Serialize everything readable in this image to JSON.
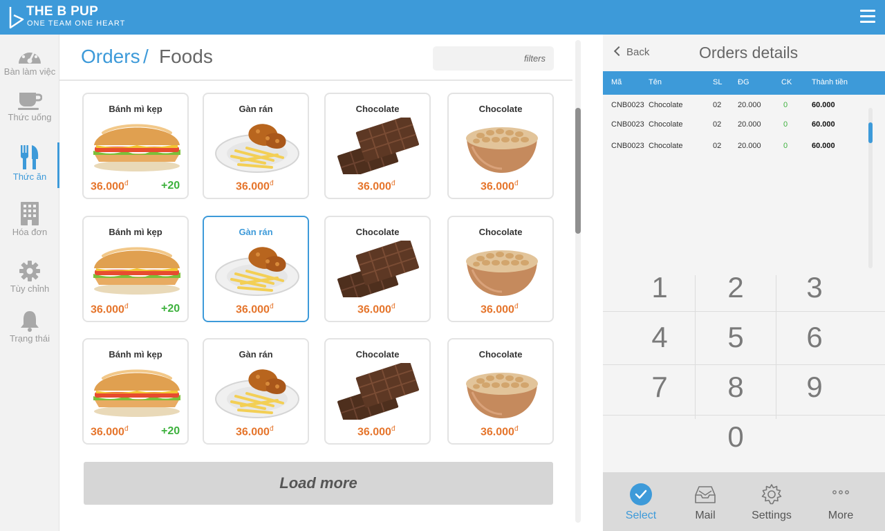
{
  "brand": {
    "title": "THE B PUP",
    "subtitle": "ONE TEAM ONE HEART"
  },
  "sidebar": {
    "items": [
      {
        "label": "Bàn làm việc",
        "icon": "dashboard-icon",
        "active": false
      },
      {
        "label": "Thức uống",
        "icon": "coffee-cup-icon",
        "active": false
      },
      {
        "label": "Thức ăn",
        "icon": "fork-knife-icon",
        "active": true
      },
      {
        "label": "Hóa đơn",
        "icon": "building-icon",
        "active": false
      },
      {
        "label": "Tùy chỉnh",
        "icon": "gear-icon",
        "active": false
      },
      {
        "label": "Trạng thái",
        "icon": "bell-icon",
        "active": false
      }
    ]
  },
  "breadcrumb": {
    "section": "Orders",
    "separator": "/",
    "page": "Foods"
  },
  "filters": {
    "placeholder": "filters"
  },
  "products": [
    {
      "name": "Bánh mì kẹp",
      "price": "36.000",
      "currency": "đ",
      "badge": "+20",
      "image": "sandwich",
      "selected": false
    },
    {
      "name": "Gàn rán",
      "price": "36.000",
      "currency": "đ",
      "badge": "",
      "image": "fried-chicken",
      "selected": false
    },
    {
      "name": "Chocolate",
      "price": "36.000",
      "currency": "đ",
      "badge": "",
      "image": "chocolate",
      "selected": false
    },
    {
      "name": "Chocolate",
      "price": "36.000",
      "currency": "đ",
      "badge": "",
      "image": "peanuts",
      "selected": false
    },
    {
      "name": "Bánh mì kẹp",
      "price": "36.000",
      "currency": "đ",
      "badge": "+20",
      "image": "sandwich",
      "selected": false
    },
    {
      "name": "Gàn rán",
      "price": "36.000",
      "currency": "đ",
      "badge": "",
      "image": "fried-chicken",
      "selected": true
    },
    {
      "name": "Chocolate",
      "price": "36.000",
      "currency": "đ",
      "badge": "",
      "image": "chocolate",
      "selected": false
    },
    {
      "name": "Chocolate",
      "price": "36.000",
      "currency": "đ",
      "badge": "",
      "image": "peanuts",
      "selected": false
    },
    {
      "name": "Bánh mì kẹp",
      "price": "36.000",
      "currency": "đ",
      "badge": "+20",
      "image": "sandwich",
      "selected": false
    },
    {
      "name": "Gàn rán",
      "price": "36.000",
      "currency": "đ",
      "badge": "",
      "image": "fried-chicken",
      "selected": false
    },
    {
      "name": "Chocolate",
      "price": "36.000",
      "currency": "đ",
      "badge": "",
      "image": "chocolate",
      "selected": false
    },
    {
      "name": "Chocolate",
      "price": "36.000",
      "currency": "đ",
      "badge": "",
      "image": "peanuts",
      "selected": false
    }
  ],
  "load_more_label": "Load more",
  "order_panel": {
    "back_label": "Back",
    "title": "Orders details",
    "columns": [
      "Mã",
      "Tên",
      "SL",
      "ĐG",
      "CK",
      "Thành tiền"
    ],
    "rows": [
      [
        "CNB0023",
        "Chocolate",
        "02",
        "20.000",
        "0",
        "60.000"
      ],
      [
        "CNB0023",
        "Chocolate",
        "02",
        "20.000",
        "0",
        "60.000"
      ],
      [
        "CNB0023",
        "Chocolate",
        "02",
        "20.000",
        "0",
        "60.000"
      ]
    ]
  },
  "keypad": [
    "1",
    "2",
    "3",
    "4",
    "5",
    "6",
    "7",
    "8",
    "9",
    "0"
  ],
  "bottom_tabs": [
    {
      "label": "Select",
      "icon": "check-circle-icon",
      "active": true
    },
    {
      "label": "Mail",
      "icon": "inbox-icon",
      "active": false
    },
    {
      "label": "Settings",
      "icon": "gear-icon",
      "active": false
    },
    {
      "label": "More",
      "icon": "more-icon",
      "active": false
    }
  ],
  "colors": {
    "primary": "#3d9ad9",
    "price": "#e5752c",
    "badge": "#3db13d",
    "sidebar_bg": "#f2f2f2",
    "panel_bg": "#f4f4f4"
  }
}
